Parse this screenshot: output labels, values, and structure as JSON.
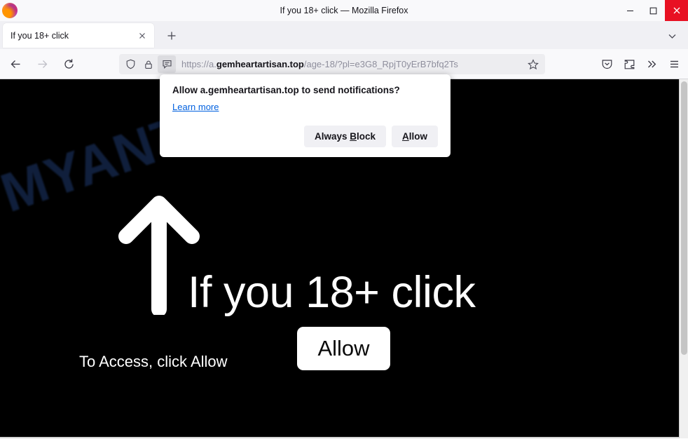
{
  "window": {
    "title": "If you 18+ click — Mozilla Firefox",
    "minimize_label": "Minimize",
    "maximize_label": "Maximize",
    "close_label": "Close"
  },
  "tabbar": {
    "tab_title": "If you 18+ click",
    "close_tab_label": "Close tab",
    "new_tab_label": "Open a new tab",
    "list_all_tabs_label": "List all tabs"
  },
  "toolbar": {
    "back_label": "Go back one page",
    "forward_label": "Go forward one page",
    "reload_label": "Reload current page",
    "tracking_protection_label": "Tracking Protection",
    "site_security_label": "Site information",
    "notification_permission_label": "Notification permission",
    "bookmark_label": "Bookmark this page",
    "pocket_label": "Save to Pocket",
    "extensions_label": "Extensions",
    "overflow_label": "More tools",
    "menu_label": "Open application menu",
    "url": {
      "scheme": "https://a.",
      "host": "gemheartartisan.top",
      "path": "/age-18/?pl=e3G8_RpjT0yErB7bfq2Ts"
    }
  },
  "notification_panel": {
    "title": "Allow a.gemheartartisan.top to send notifications?",
    "learn_more": "Learn more",
    "always_block_pre": "Always ",
    "always_block_key": "B",
    "always_block_post": "lock",
    "allow_key": "A",
    "allow_post": "llow"
  },
  "page": {
    "watermark": "MYANTISPYWARE.COM",
    "headline": "If you 18+ click",
    "subtext": "To Access, click Allow",
    "allow_button": "Allow",
    "background_color": "#000000",
    "watermark_color": "#101f3c",
    "button_color": "#ffffff"
  }
}
